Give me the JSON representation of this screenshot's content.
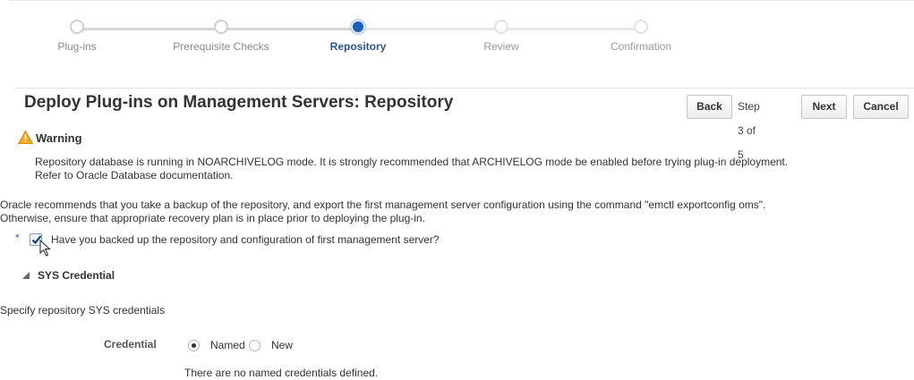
{
  "train": {
    "steps": [
      {
        "label": "Plug-ins",
        "state": "visited"
      },
      {
        "label": "Prerequisite Checks",
        "state": "visited"
      },
      {
        "label": "Repository",
        "state": "current"
      },
      {
        "label": "Review",
        "state": "future"
      },
      {
        "label": "Confirmation",
        "state": "future"
      }
    ]
  },
  "header": {
    "title": "Deploy Plug-ins on Management Servers: Repository",
    "back_label": "Back",
    "step_text": "Step 3 of 5",
    "next_label": "Next",
    "cancel_label": "Cancel"
  },
  "warning": {
    "title": "Warning",
    "message_line1": "Repository database is running in NOARCHIVELOG mode. It is strongly recommended that ARCHIVELOG mode be enabled before trying plug-in deployment.",
    "message_line2": "Refer to Oracle Database documentation."
  },
  "info": {
    "line1": "Oracle recommends that you take a backup of the repository, and export the first management server configuration using the command \"emctl exportconfig oms\".",
    "line2": "Otherwise, ensure that appropriate recovery plan is in place prior to deploying the plug-in."
  },
  "backup_check": {
    "required_marker": "*",
    "label": "Have you backed up the repository and configuration of first management server?",
    "checked": true
  },
  "sys_credential": {
    "title": "SYS Credential",
    "description": "Specify repository SYS credentials",
    "credential_label": "Credential",
    "options": [
      "Named",
      "New"
    ],
    "selected": "Named",
    "empty_message": "There are no named credentials defined."
  },
  "colors": {
    "accent": "#1a62b8",
    "warning_icon": "#f5a623",
    "current_step_text": "#2b5797"
  }
}
